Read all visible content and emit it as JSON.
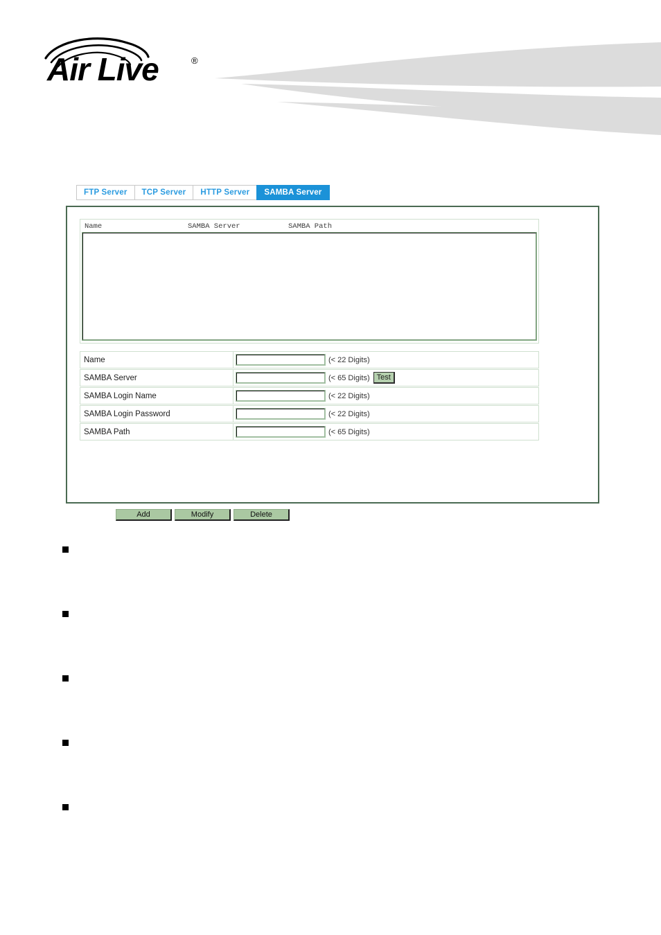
{
  "brand": {
    "name": "Air Live",
    "trademark": "®",
    "logo_icon": "airlive-wireless-logo"
  },
  "tabs": [
    {
      "label": "FTP Server",
      "active": false
    },
    {
      "label": "TCP Server",
      "active": false
    },
    {
      "label": "HTTP Server",
      "active": false
    },
    {
      "label": "SAMBA Server",
      "active": true
    }
  ],
  "server_list": {
    "columns": [
      "Name",
      "SAMBA Server",
      "SAMBA Path"
    ],
    "rows": []
  },
  "form": {
    "rows": [
      {
        "label": "Name",
        "value": "",
        "hint": "(< 22 Digits)",
        "has_test": false
      },
      {
        "label": "SAMBA Server",
        "value": "",
        "hint": "(< 65 Digits)",
        "has_test": true,
        "test_label": "Test"
      },
      {
        "label": "SAMBA Login Name",
        "value": "",
        "hint": "(< 22 Digits)",
        "has_test": false
      },
      {
        "label": "SAMBA Login Password",
        "value": "",
        "hint": "(< 22 Digits)",
        "has_test": false
      },
      {
        "label": "SAMBA Path",
        "value": "",
        "hint": "(< 65 Digits)",
        "has_test": false
      }
    ]
  },
  "actions": [
    {
      "label": "Add"
    },
    {
      "label": "Modify"
    },
    {
      "label": "Delete"
    }
  ],
  "notes": [
    {
      "text": ""
    },
    {
      "text": ""
    },
    {
      "text": ""
    },
    {
      "text": ""
    },
    {
      "text": ""
    }
  ],
  "colors": {
    "tab_active_bg": "#1b92d8",
    "tab_inactive_text": "#2a9be0",
    "panel_border": "#4a6a52",
    "field_border": "#cfe0cf",
    "button_green": "#aac8a2",
    "swoosh_gray": "#dcdcdc"
  }
}
